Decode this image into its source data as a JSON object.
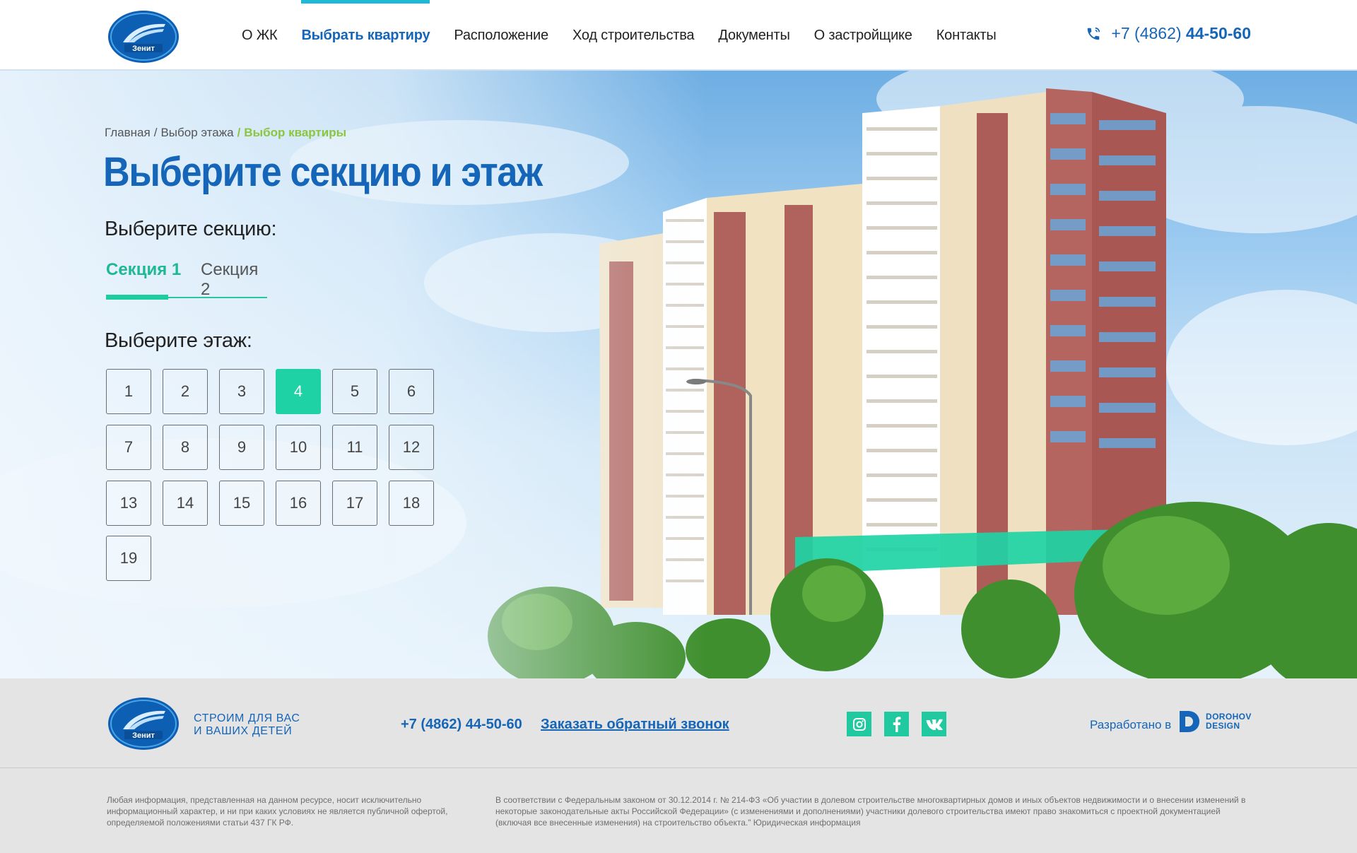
{
  "header": {
    "logo_text": "Зенит",
    "nav": [
      {
        "label": "О ЖК",
        "active": false
      },
      {
        "label": "Выбрать квартиру",
        "active": true
      },
      {
        "label": "Расположение",
        "active": false
      },
      {
        "label": "Ход строительства",
        "active": false
      },
      {
        "label": "Документы",
        "active": false
      },
      {
        "label": "О застройщике",
        "active": false
      },
      {
        "label": "Контакты",
        "active": false
      }
    ],
    "phone_prefix": "+7 (4862) ",
    "phone_number": "44-50-60"
  },
  "breadcrumb": {
    "home": "Главная",
    "floor_select": "Выбор этажа",
    "current": "Выбор квартиры",
    "separator": "/"
  },
  "title": "Выберите секцию и этаж",
  "section_label": "Выберите секцию:",
  "sections": [
    "Секция 1",
    "Секция 2"
  ],
  "selected_section": "Секция 1",
  "floor_label": "Выберите этаж:",
  "floors": [
    "1",
    "2",
    "3",
    "4",
    "5",
    "6",
    "7",
    "8",
    "9",
    "10",
    "11",
    "12",
    "13",
    "14",
    "15",
    "16",
    "17",
    "18",
    "19"
  ],
  "selected_floor": "4",
  "colors": {
    "brand_blue": "#1565b8",
    "accent_green": "#1ed2a5",
    "breadcrumb_current": "#8cc63f"
  },
  "footer": {
    "logo_text": "Зенит",
    "slogan_line1": "Строим для вас",
    "slogan_line2": "и ваших детей",
    "phone": "+7 (4862) 44-50-60",
    "callback": "Заказать обратный звонок",
    "socials": [
      "instagram-icon",
      "facebook-icon",
      "vk-icon"
    ],
    "developed_by": "Разработано в",
    "dev_logo_line1": "DOROHOV",
    "dev_logo_line2": "DESIGN",
    "legal_left": "Любая информация, представленная на данном ресурсе, носит исключительно информационный характер, и ни при каких условиях не является публичной офертой, определяемой положениями статьи 437 ГК РФ.",
    "legal_right": "В соответствии с Федеральным законом от 30.12.2014 г. № 214-ФЗ «Об участии в долевом строительстве многоквартирных домов и иных объектов недвижимости и о внесении изменений в некоторые законодательные акты Российской Федерации» (с изменениями и дополнениями) участники долевого строительства имеют право знакомиться с проектной документацией (включая все внесенные изменения) на строительство объекта.\" Юридическая информация"
  }
}
